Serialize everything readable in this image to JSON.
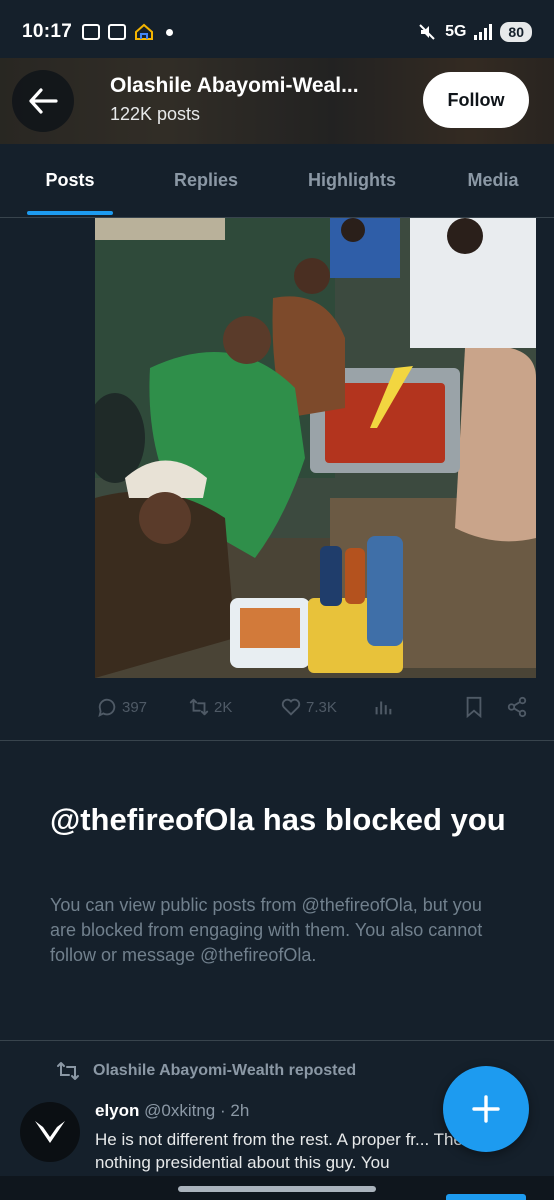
{
  "status_bar": {
    "time": "10:17",
    "network": "5G",
    "battery": "80"
  },
  "header": {
    "name": "Olashile Abayomi-Weal...",
    "posts": "122K posts",
    "follow_label": "Follow"
  },
  "tabs": [
    {
      "label": "Posts",
      "active": true
    },
    {
      "label": "Replies",
      "active": false
    },
    {
      "label": "Highlights",
      "active": false
    },
    {
      "label": "Media",
      "active": false
    }
  ],
  "post_actions": {
    "replies": "397",
    "reposts": "2K",
    "likes": "7.3K"
  },
  "blocked": {
    "title": "@thefireofOla has blocked you",
    "body": "You can view public posts from @thefireofOla, but you are blocked from engaging with them. You also cannot follow or message @thefireofOla."
  },
  "repost": {
    "reposted_by": "Olashile Abayomi-Wealth reposted",
    "author_name": "elyon",
    "author_handle": "@0xkitng",
    "time": "· 2h",
    "text": "He is not different from the rest. A proper fr... There is nothing presidential about this guy. You"
  },
  "colors": {
    "background": "#15202b",
    "accent": "#1d9bf0",
    "muted": "#8b98a5"
  }
}
